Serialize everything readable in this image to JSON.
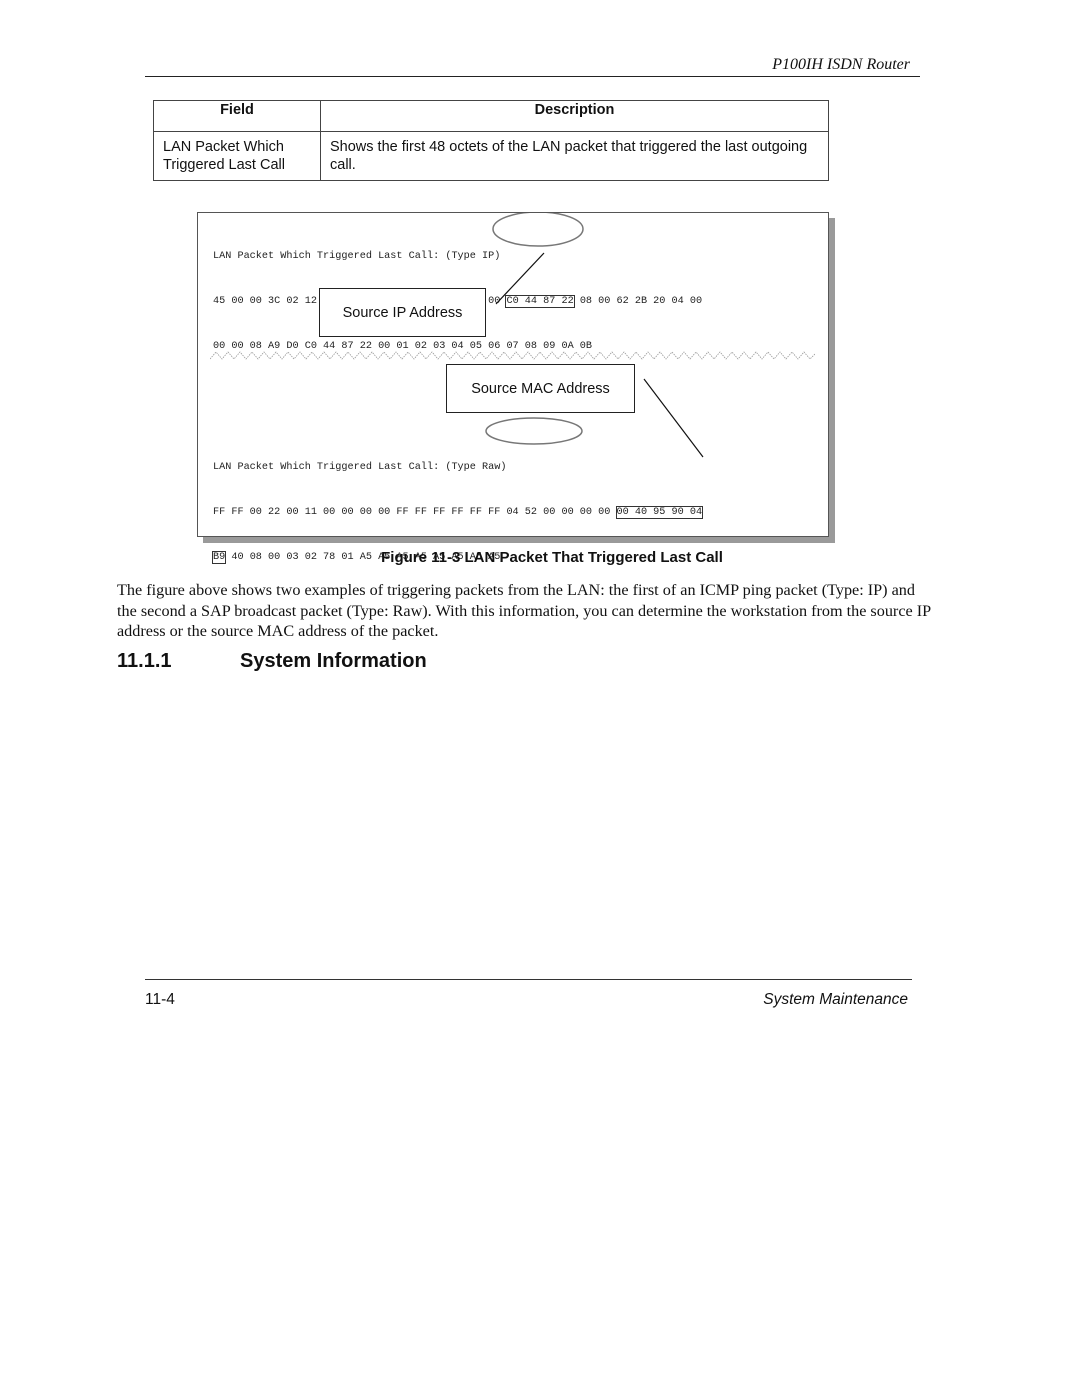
{
  "header": {
    "running_title": "P100IH ISDN Router"
  },
  "field_table": {
    "columns": [
      "Field",
      "Description"
    ],
    "rows": [
      {
        "field": "LAN Packet Which Triggered Last Call",
        "description": "Shows the first 48 octets of the LAN packet that triggered the last outgoing call."
      }
    ]
  },
  "figure": {
    "ip_example": {
      "title_prefix": "LAN Packet Which Triggered Last Call: ",
      "type_label": "(Type IP)",
      "line1_pre": "45 00 00 3C 02 12 00 00 3B 01 36 49 00 00 00 00 ",
      "line1_boxed": "C0 44 87 22",
      "line1_post": " 08 00 62 2B 20 04 00",
      "line2": "00 00 08 A9 D0 C0 44 87 22 00 01 02 03 04 05 06 07 08 09 0A 0B",
      "callout": "Source IP Address"
    },
    "raw_example": {
      "title_prefix": "LAN Packet Which Triggered Last Call: ",
      "type_label": "(Type Raw)",
      "line1_pre": "FF FF 00 22 00 11 00 00 00 00 FF FF FF FF FF FF 04 52 00 00 00 00 ",
      "line1_boxed": "00 40 95 90 04",
      "line2_boxed": "B9",
      "line2_post": " 40 08 00 03 02 78 01 A5 A5 A5 A5 A5 A5 A5 A5",
      "callout": "Source MAC Address"
    },
    "caption": "Figure 11-3 LAN Packet That Triggered Last Call"
  },
  "body_text": "The figure above shows two examples of triggering packets from the LAN: the first of an ICMP ping packet (Type: IP) and the second a SAP broadcast packet (Type: Raw). With this information, you can determine the workstation from the source IP address or the source MAC address of the packet.",
  "section": {
    "number": "11.1.1",
    "title": "System Information"
  },
  "footer": {
    "page_number": "11-4",
    "chapter": "System Maintenance"
  }
}
